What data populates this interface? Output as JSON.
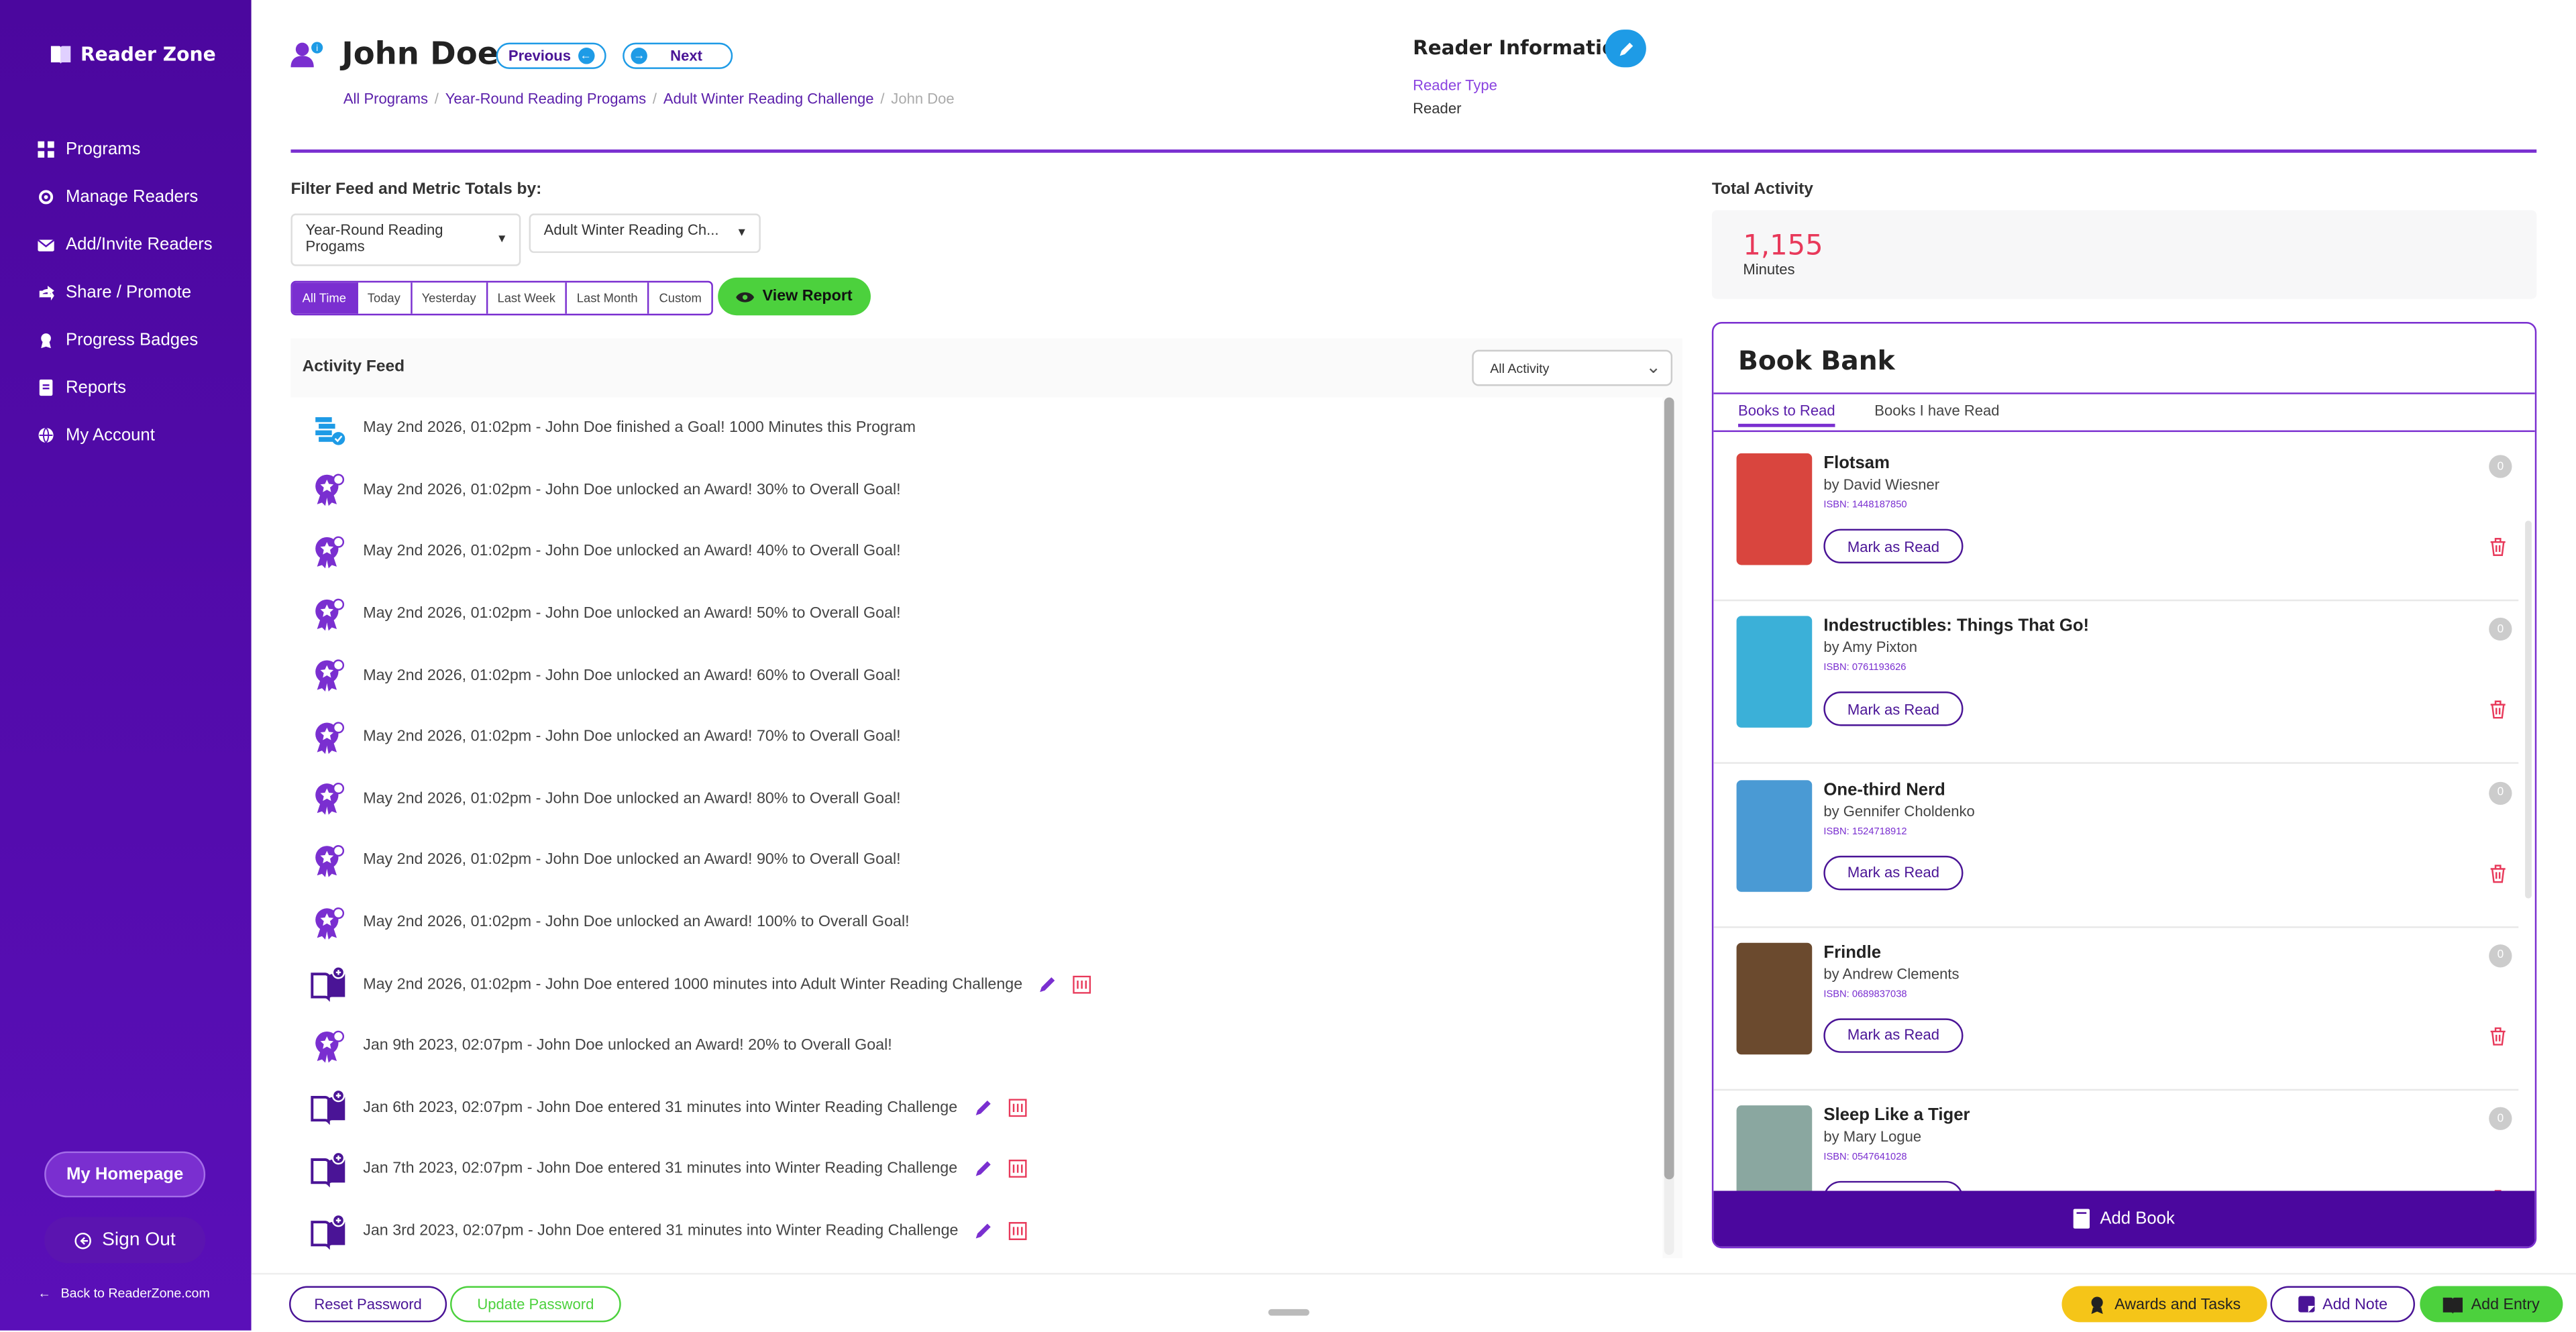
{
  "sidebar": {
    "logo": "Reader Zone",
    "items": [
      {
        "label": "Programs",
        "icon": "grid-icon"
      },
      {
        "label": "Manage Readers",
        "icon": "gear-icon"
      },
      {
        "label": "Add/Invite Readers",
        "icon": "envelope-icon"
      },
      {
        "label": "Share / Promote",
        "icon": "share-icon"
      },
      {
        "label": "Progress Badges",
        "icon": "badge-icon"
      },
      {
        "label": "Reports",
        "icon": "report-icon"
      },
      {
        "label": "My Account",
        "icon": "globe-icon"
      }
    ],
    "home_button": "My Homepage",
    "signout_button": "Sign Out",
    "back_link": "Back to ReaderZone.com"
  },
  "header": {
    "name": "John Doe",
    "previous": "Previous",
    "next": "Next",
    "breadcrumb": [
      "All Programs",
      "Year-Round Reading Progams",
      "Adult Winter Reading Challenge",
      "John Doe"
    ]
  },
  "reader_info": {
    "title": "Reader Information",
    "type_label": "Reader Type",
    "type_value": "Reader"
  },
  "filters": {
    "label": "Filter Feed and Metric Totals by:",
    "program_select": "Year-Round Reading Progams",
    "challenge_select": "Adult Winter Reading Ch...",
    "ranges": [
      "All Time",
      "Today",
      "Yesterday",
      "Last Week",
      "Last Month",
      "Custom"
    ],
    "active_range": "All Time",
    "view_report": "View Report"
  },
  "feed": {
    "title": "Activity Feed",
    "filter_value": "All Activity",
    "rows": [
      {
        "type": "goal",
        "text": "May 2nd 2026, 01:02pm - John Doe finished a Goal! 1000 Minutes this Program",
        "editable": false
      },
      {
        "type": "award",
        "text": "May 2nd 2026, 01:02pm - John Doe unlocked an Award! 30% to Overall Goal!",
        "editable": false
      },
      {
        "type": "award",
        "text": "May 2nd 2026, 01:02pm - John Doe unlocked an Award! 40% to Overall Goal!",
        "editable": false
      },
      {
        "type": "award",
        "text": "May 2nd 2026, 01:02pm - John Doe unlocked an Award! 50% to Overall Goal!",
        "editable": false
      },
      {
        "type": "award",
        "text": "May 2nd 2026, 01:02pm - John Doe unlocked an Award! 60% to Overall Goal!",
        "editable": false
      },
      {
        "type": "award",
        "text": "May 2nd 2026, 01:02pm - John Doe unlocked an Award! 70% to Overall Goal!",
        "editable": false
      },
      {
        "type": "award",
        "text": "May 2nd 2026, 01:02pm - John Doe unlocked an Award! 80% to Overall Goal!",
        "editable": false
      },
      {
        "type": "award",
        "text": "May 2nd 2026, 01:02pm - John Doe unlocked an Award! 90% to Overall Goal!",
        "editable": false
      },
      {
        "type": "award",
        "text": "May 2nd 2026, 01:02pm - John Doe unlocked an Award! 100% to Overall Goal!",
        "editable": false
      },
      {
        "type": "entry",
        "text": "May 2nd 2026, 01:02pm - John Doe entered 1000 minutes into Adult Winter Reading Challenge",
        "editable": true
      },
      {
        "type": "award",
        "text": "Jan 9th 2023, 02:07pm - John Doe unlocked an Award! 20% to Overall Goal!",
        "editable": false
      },
      {
        "type": "entry",
        "text": "Jan 6th 2023, 02:07pm - John Doe entered 31 minutes into Winter Reading Challenge",
        "editable": true
      },
      {
        "type": "entry",
        "text": "Jan 7th 2023, 02:07pm - John Doe entered 31 minutes into Winter Reading Challenge",
        "editable": true
      },
      {
        "type": "entry",
        "text": "Jan 3rd 2023, 02:07pm - John Doe entered 31 minutes into Winter Reading Challenge",
        "editable": true
      }
    ]
  },
  "total_activity": {
    "title": "Total Activity",
    "value": "1,155",
    "unit": "Minutes"
  },
  "book_bank": {
    "title": "Book Bank",
    "tabs": [
      "Books to Read",
      "Books I have Read"
    ],
    "active_tab": "Books to Read",
    "mark_label": "Mark as Read",
    "books": [
      {
        "title": "Flotsam",
        "author": "by David Wiesner",
        "isbn": "ISBN: 1448187850",
        "count": "0",
        "cover": "#d9453e"
      },
      {
        "title": "Indestructibles: Things That Go!",
        "author": "by Amy Pixton",
        "isbn": "ISBN: 0761193626",
        "count": "0",
        "cover": "#3bb0d8"
      },
      {
        "title": "One-third Nerd",
        "author": "by Gennifer Choldenko",
        "isbn": "ISBN: 1524718912",
        "count": "0",
        "cover": "#4a9ad4"
      },
      {
        "title": "Frindle",
        "author": "by Andrew Clements",
        "isbn": "ISBN: 0689837038",
        "count": "0",
        "cover": "#6b4a2e"
      },
      {
        "title": "Sleep Like a Tiger",
        "author": "by Mary Logue",
        "isbn": "ISBN: 0547641028",
        "count": "0",
        "cover": "#8aa7a0"
      }
    ],
    "add_book": "Add Book"
  },
  "footer": {
    "reset_password": "Reset Password",
    "update_password": "Update Password",
    "awards_tasks": "Awards and Tasks",
    "add_note": "Add Note",
    "add_entry": "Add Entry"
  },
  "colors": {
    "primary": "#4b079e",
    "accent_blue": "#1e9be6",
    "accent_green": "#4cd13d",
    "accent_red": "#e8395a",
    "accent_yellow": "#f5c518"
  }
}
